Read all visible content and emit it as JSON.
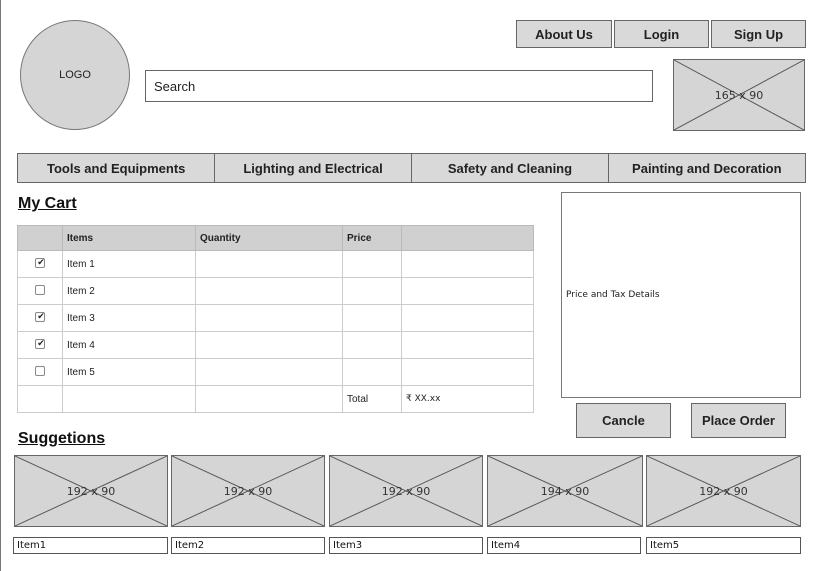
{
  "header": {
    "logo_text": "LOGO",
    "nav_links": {
      "about": "About Us",
      "login": "Login",
      "signup": "Sign Up"
    },
    "search": {
      "value": "Search"
    },
    "banner_image": "165 x 90"
  },
  "categories": [
    "Tools and Equipments",
    "Lighting and Electrical",
    "Safety and Cleaning",
    "Painting and Decoration"
  ],
  "cart": {
    "title": "My Cart",
    "columns": [
      "",
      "Items",
      "Quantity",
      "Price",
      ""
    ],
    "rows": [
      {
        "checked": true,
        "item": "Item 1"
      },
      {
        "checked": false,
        "item": "Item 2"
      },
      {
        "checked": true,
        "item": "Item 3"
      },
      {
        "checked": true,
        "item": "Item 4"
      },
      {
        "checked": false,
        "item": "Item 5"
      }
    ],
    "total_label": "Total",
    "total_value": "₹ XX.xx"
  },
  "price_panel": {
    "text": "Price and Tax Details"
  },
  "actions": {
    "cancel": "Cancle",
    "place_order": "Place Order"
  },
  "suggestions": {
    "title": "Suggetions",
    "items": [
      {
        "image": "192 x 90",
        "label": "Item1"
      },
      {
        "image": "192 x 90",
        "label": "Item2"
      },
      {
        "image": "192 x 90",
        "label": "Item3"
      },
      {
        "image": "194 x 90",
        "label": "Item4"
      },
      {
        "image": "192 x 90",
        "label": "Item5"
      }
    ]
  },
  "colors": {
    "button_fill": "#d9d9d9",
    "placeholder_fill": "#d5d5d5",
    "header_row": "#d0d0d0"
  }
}
